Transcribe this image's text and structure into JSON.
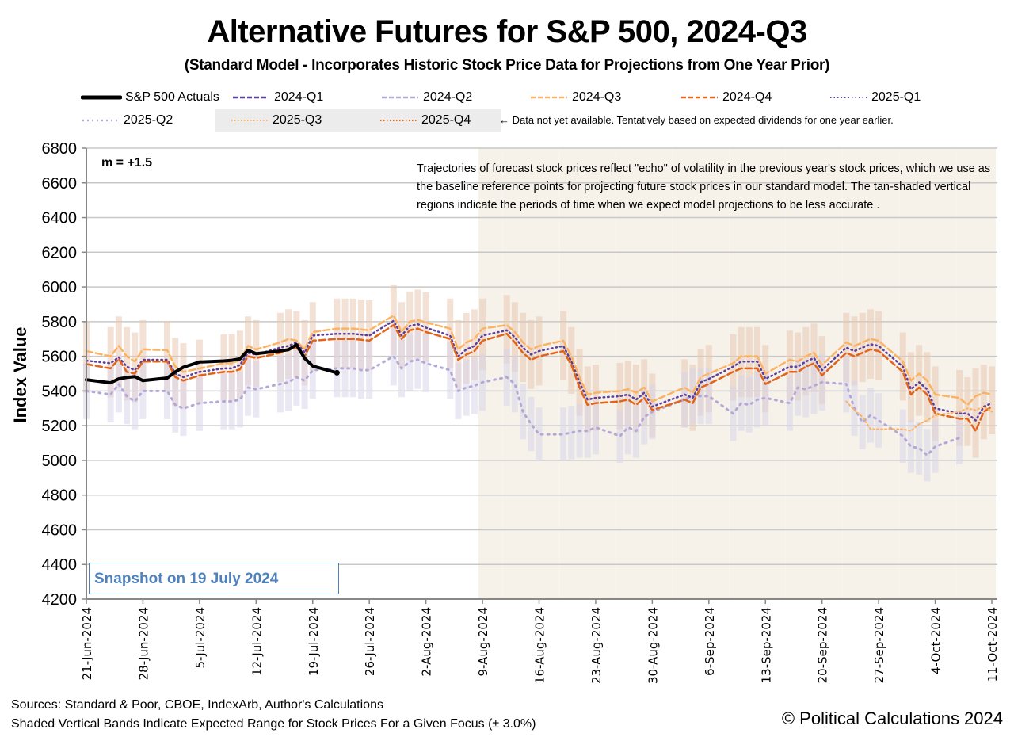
{
  "title": "Alternative Futures for S&P 500, 2024-Q3",
  "subtitle": "(Standard Model - Incorporates Historic Stock Price Data for Projections from One Year Prior)",
  "legend": {
    "items": [
      {
        "label": "S&P 500 Actuals",
        "color": "#000000",
        "style": "solid"
      },
      {
        "label": "2024-Q1",
        "color": "#5b3f9c",
        "style": "dashed"
      },
      {
        "label": "2024-Q2",
        "color": "#b4a9d6",
        "style": "dashed"
      },
      {
        "label": "2024-Q3",
        "color": "#fbb363",
        "style": "dashed"
      },
      {
        "label": "2024-Q4",
        "color": "#e2641a",
        "style": "dashed"
      },
      {
        "label": "2025-Q1",
        "color": "#5b3f9c",
        "style": "dotted"
      },
      {
        "label": "2025-Q2",
        "color": "#b4a9d6",
        "style": "dotted"
      },
      {
        "label": "2025-Q3",
        "color": "#fbb363",
        "style": "dotted"
      },
      {
        "label": "2025-Q4",
        "color": "#e2641a",
        "style": "dotted"
      }
    ],
    "note": "← Data not yet available.  Tentatively based on expected dividends for one year earlier."
  },
  "annotations": {
    "m_value": "m = +1.5",
    "description": "Trajectories of forecast stock prices reflect \"echo\" of volatility in  the previous year's stock prices, which we use as the baseline reference points for projecting future stock prices in our standard model.   The tan-shaded vertical regions indicate the periods of time when we expect model projections to be less accurate .",
    "snapshot": "Snapshot on 19 July 2024"
  },
  "footer": {
    "sources": "Sources: Standard & Poor, CBOE, IndexArb, Author's Calculations",
    "bands_note": "Shaded Vertical Bands Indicate Expected Range for Stock Prices For a Given Focus (± 3.0%)",
    "copyright": "© Political Calculations 2024"
  },
  "chart_data": {
    "type": "line",
    "title": "Alternative Futures for S&P 500, 2024-Q3",
    "xlabel": "",
    "ylabel": "Index Value",
    "ylim": [
      4200,
      6800
    ],
    "yticks": [
      4200,
      4400,
      4600,
      4800,
      5000,
      5200,
      5400,
      5600,
      5800,
      6000,
      6200,
      6400,
      6600,
      6800
    ],
    "xlim_days": [
      0,
      112
    ],
    "xtick_labels": [
      "21-Jun-2024",
      "28-Jun-2024",
      "5-Jul-2024",
      "12-Jul-2024",
      "19-Jul-2024",
      "26-Jul-2024",
      "2-Aug-2024",
      "9-Aug-2024",
      "16-Aug-2024",
      "23-Aug-2024",
      "30-Aug-2024",
      "6-Sep-2024",
      "13-Sep-2024",
      "20-Sep-2024",
      "27-Sep-2024",
      "4-Oct-2024",
      "11-Oct-2024"
    ],
    "grid": true,
    "band_pct": 3.0,
    "low_accuracy_periods_days": [
      [
        49,
        51
      ],
      [
        52,
        58
      ],
      [
        59,
        65
      ],
      [
        66,
        72
      ],
      [
        73,
        79
      ],
      [
        80,
        86
      ],
      [
        87,
        93
      ],
      [
        94,
        100
      ],
      [
        101,
        107
      ],
      [
        108,
        112
      ]
    ],
    "day_offsets": [
      0,
      3,
      4,
      5,
      6,
      7,
      10,
      11,
      12,
      14,
      17,
      18,
      19,
      20,
      21,
      24,
      25,
      26,
      27,
      28,
      31,
      32,
      33,
      34,
      35,
      38,
      39,
      40,
      41,
      42,
      45,
      46,
      47,
      48,
      49,
      52,
      53,
      54,
      55,
      56,
      59,
      60,
      61,
      62,
      63,
      66,
      67,
      68,
      69,
      70,
      74,
      75,
      76,
      77,
      80,
      81,
      82,
      83,
      84,
      87,
      88,
      89,
      90,
      91,
      94,
      95,
      96,
      97,
      98,
      101,
      102,
      103,
      104,
      105,
      108,
      109,
      110,
      111,
      112
    ],
    "series": [
      {
        "name": "S&P 500 Actuals",
        "values": [
          5465,
          5447,
          5470,
          5478,
          5483,
          5460,
          5475,
          5510,
          5537,
          5567,
          5573,
          5577,
          5585,
          5635,
          5615,
          5631,
          5638,
          5667,
          5589,
          5544,
          5505
        ]
      },
      {
        "name": "2024-Q3",
        "values": [
          5630,
          5600,
          5660,
          5600,
          5570,
          5640,
          5635,
          5540,
          5510,
          5530,
          5560,
          5560,
          5580,
          5660,
          5640,
          5680,
          5700,
          5690,
          5640,
          5740,
          5760,
          5760,
          5760,
          5755,
          5750,
          5835,
          5740,
          5800,
          5810,
          5795,
          5760,
          5640,
          5680,
          5700,
          5760,
          5780,
          5740,
          5680,
          5640,
          5660,
          5690,
          5600,
          5480,
          5380,
          5390,
          5400,
          5410,
          5390,
          5420,
          5340,
          5420,
          5390,
          5480,
          5500,
          5560,
          5600,
          5600,
          5600,
          5500,
          5580,
          5570,
          5600,
          5620,
          5550,
          5680,
          5660,
          5680,
          5700,
          5690,
          5570,
          5460,
          5500,
          5460,
          5380,
          5360,
          5320,
          5370,
          5390,
          5380
        ]
      },
      {
        "name": "2025-Q1",
        "values": [
          5575,
          5560,
          5595,
          5540,
          5520,
          5580,
          5580,
          5500,
          5480,
          5510,
          5530,
          5530,
          5550,
          5620,
          5610,
          5650,
          5660,
          5680,
          5620,
          5720,
          5730,
          5730,
          5730,
          5725,
          5720,
          5805,
          5720,
          5775,
          5785,
          5765,
          5720,
          5600,
          5640,
          5660,
          5720,
          5750,
          5710,
          5650,
          5610,
          5630,
          5660,
          5570,
          5450,
          5350,
          5360,
          5370,
          5380,
          5350,
          5390,
          5310,
          5380,
          5360,
          5450,
          5470,
          5540,
          5570,
          5570,
          5570,
          5470,
          5540,
          5540,
          5570,
          5590,
          5520,
          5650,
          5630,
          5650,
          5670,
          5660,
          5540,
          5410,
          5450,
          5410,
          5300,
          5270,
          5270,
          5230,
          5310,
          5330
        ]
      },
      {
        "name": "2024-Q4",
        "values": [
          5555,
          5530,
          5585,
          5510,
          5500,
          5570,
          5570,
          5480,
          5460,
          5490,
          5510,
          5510,
          5525,
          5600,
          5590,
          5620,
          5640,
          5650,
          5600,
          5690,
          5700,
          5700,
          5700,
          5695,
          5690,
          5780,
          5700,
          5750,
          5760,
          5740,
          5700,
          5580,
          5610,
          5630,
          5690,
          5730,
          5680,
          5620,
          5580,
          5600,
          5630,
          5550,
          5420,
          5320,
          5330,
          5340,
          5350,
          5320,
          5360,
          5290,
          5350,
          5330,
          5420,
          5440,
          5510,
          5530,
          5530,
          5530,
          5440,
          5510,
          5510,
          5540,
          5560,
          5490,
          5620,
          5600,
          5620,
          5640,
          5630,
          5510,
          5380,
          5420,
          5380,
          5270,
          5240,
          5240,
          5170,
          5280,
          5310
        ]
      },
      {
        "name": "2025-Q2",
        "values": [
          5400,
          5380,
          5440,
          5370,
          5340,
          5400,
          5400,
          5320,
          5300,
          5330,
          5340,
          5340,
          5350,
          5420,
          5410,
          5440,
          5450,
          5480,
          5460,
          5520,
          5530,
          5530,
          5530,
          5520,
          5520,
          5600,
          5530,
          5570,
          5580,
          5560,
          5520,
          5400,
          5420,
          5430,
          5450,
          5480,
          5440,
          5280,
          5210,
          5150,
          5150,
          5160,
          5170,
          5170,
          5190,
          5140,
          5190,
          5170,
          5250,
          5280,
          5350,
          5370,
          5370,
          5370,
          5270,
          5330,
          5320,
          5350,
          5360,
          5330,
          5420,
          5410,
          5430,
          5450,
          5440,
          5300,
          5220,
          5260,
          5230,
          5140,
          5080,
          5070,
          5030,
          5080,
          5130
        ]
      },
      {
        "name": "2025-Q3",
        "values": [
          5340,
          5290,
          5250,
          5180,
          5180,
          5180,
          5170,
          5210,
          5230,
          5260,
          5280,
          5300,
          5290,
          5310,
          5280
        ]
      }
    ],
    "q3_2025_start_index": 64
  }
}
